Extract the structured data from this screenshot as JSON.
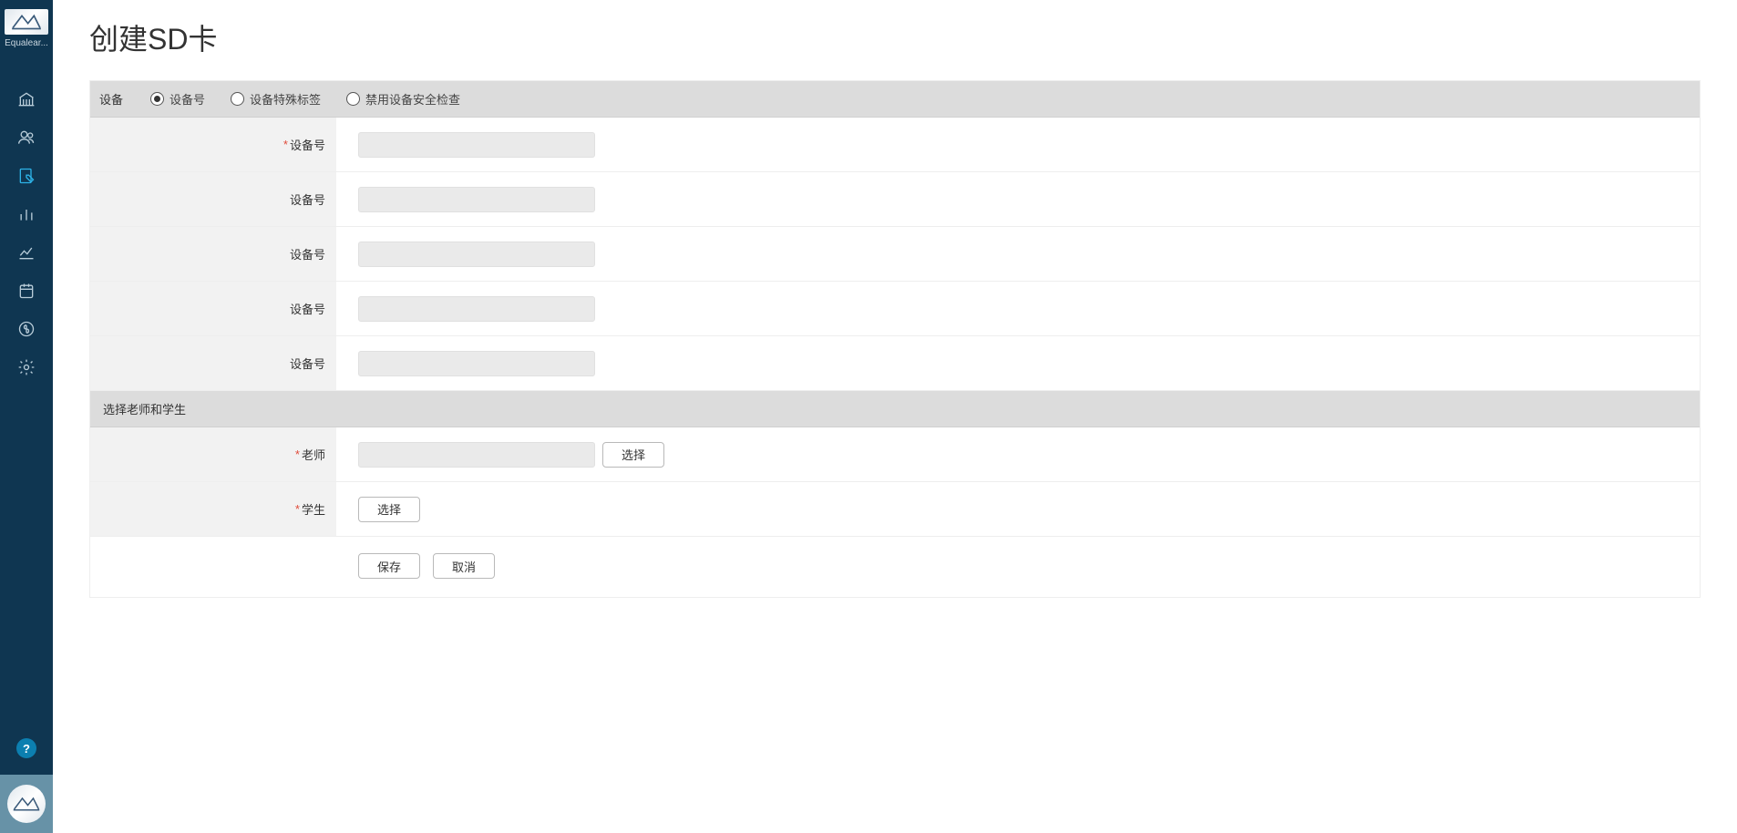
{
  "brand": {
    "label": "Equalear..."
  },
  "sidebar": {
    "items": [
      {
        "name": "institution-icon"
      },
      {
        "name": "users-icon"
      },
      {
        "name": "edit-doc-icon",
        "active": true
      },
      {
        "name": "barchart-icon"
      },
      {
        "name": "linechart-icon"
      },
      {
        "name": "calendar-icon"
      },
      {
        "name": "currency-icon"
      },
      {
        "name": "settings-gear-icon"
      }
    ],
    "help": "?"
  },
  "page": {
    "title": "创建SD卡"
  },
  "device_section": {
    "header_label": "设备",
    "radios": [
      {
        "label": "设备号",
        "selected": true
      },
      {
        "label": "设备特殊标签",
        "selected": false
      },
      {
        "label": "禁用设备安全检查",
        "selected": false
      }
    ],
    "rows": [
      {
        "label": "设备号",
        "required": true,
        "value": ""
      },
      {
        "label": "设备号",
        "required": false,
        "value": ""
      },
      {
        "label": "设备号",
        "required": false,
        "value": ""
      },
      {
        "label": "设备号",
        "required": false,
        "value": ""
      },
      {
        "label": "设备号",
        "required": false,
        "value": ""
      }
    ]
  },
  "people_section": {
    "header_label": "选择老师和学生",
    "teacher": {
      "label": "老师",
      "required": true,
      "value": "",
      "select_btn": "选择"
    },
    "student": {
      "label": "学生",
      "required": true,
      "select_btn": "选择"
    }
  },
  "actions": {
    "save": "保存",
    "cancel": "取消"
  }
}
